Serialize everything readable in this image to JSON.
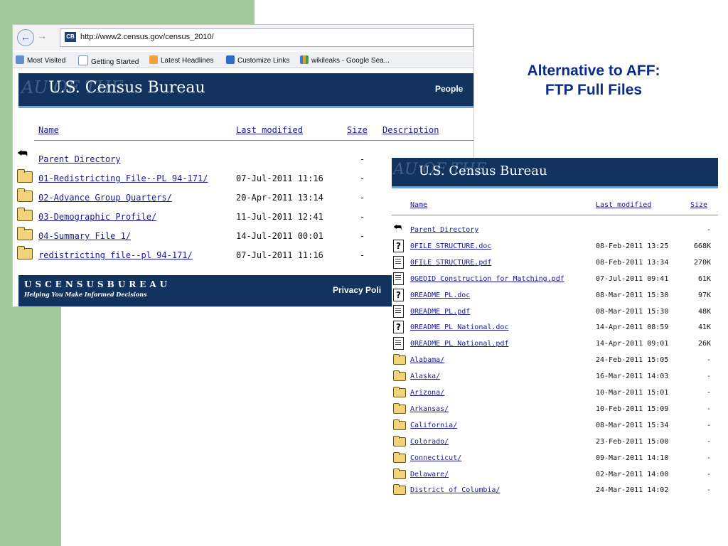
{
  "slide": {
    "title_lines": [
      "Alternative to AFF:",
      "FTP Full Files"
    ]
  },
  "browser": {
    "url": "http://www2.census.gov/census_2010/",
    "site_icon_text": "CB",
    "bookmarks": [
      "Most Visited",
      "Getting Started",
      "Latest Headlines",
      "Customize Links",
      "wikileaks - Google Sea..."
    ]
  },
  "census": {
    "logo_text": "U.S. Census Bureau",
    "watermark_text": "AU OF THE",
    "nav_people": "People",
    "footer_brand": "USCENSUSBUREAU",
    "footer_tagline": "Helping You Make Informed Decisions",
    "footer_privacy": "Privacy Poli"
  },
  "listing1": {
    "headers": {
      "name": "Name",
      "modified": "Last modified",
      "size": "Size",
      "description": "Description"
    },
    "rows": [
      {
        "icon": "back",
        "name": "Parent Directory",
        "modified": "",
        "size": "-"
      },
      {
        "icon": "folder",
        "name": "01-Redistricting File--PL 94-171/",
        "modified": "07-Jul-2011 11:16",
        "size": "-"
      },
      {
        "icon": "folder",
        "name": "02-Advance Group Quarters/",
        "modified": "20-Apr-2011 13:14",
        "size": "-"
      },
      {
        "icon": "folder",
        "name": "03-Demographic Profile/",
        "modified": "11-Jul-2011 12:41",
        "size": "-"
      },
      {
        "icon": "folder",
        "name": "04-Summary File 1/",
        "modified": "14-Jul-2011 00:01",
        "size": "-"
      },
      {
        "icon": "folder",
        "name": "redistricting file--pl 94-171/",
        "modified": "07-Jul-2011 11:16",
        "size": "-"
      }
    ]
  },
  "listing2": {
    "headers": {
      "name": "Name",
      "modified": "Last modified",
      "size": "Size"
    },
    "rows": [
      {
        "icon": "back",
        "name": "Parent Directory",
        "modified": "",
        "size": "-"
      },
      {
        "icon": "unknown",
        "name": "0FILE STRUCTURE.doc",
        "modified": "08-Feb-2011 13:25",
        "size": "668K"
      },
      {
        "icon": "text",
        "name": "0FILE STRUCTURE.pdf",
        "modified": "08-Feb-2011 13:34",
        "size": "270K"
      },
      {
        "icon": "text",
        "name": "0GEOID Construction for Matching.pdf",
        "modified": "07-Jul-2011 09:41",
        "size": "61K"
      },
      {
        "icon": "unknown",
        "name": "0README PL.doc",
        "modified": "08-Mar-2011 15:30",
        "size": "97K"
      },
      {
        "icon": "text",
        "name": "0README PL.pdf",
        "modified": "08-Mar-2011 15:30",
        "size": "48K"
      },
      {
        "icon": "unknown",
        "name": "0README PL National.doc",
        "modified": "14-Apr-2011 08:59",
        "size": "41K"
      },
      {
        "icon": "text",
        "name": "0README PL National.pdf",
        "modified": "14-Apr-2011 09:01",
        "size": "26K"
      },
      {
        "icon": "folder",
        "name": "Alabama/",
        "modified": "24-Feb-2011 15:05",
        "size": "-"
      },
      {
        "icon": "folder",
        "name": "Alaska/",
        "modified": "16-Mar-2011 14:03",
        "size": "-"
      },
      {
        "icon": "folder",
        "name": "Arizona/",
        "modified": "10-Mar-2011 15:01",
        "size": "-"
      },
      {
        "icon": "folder",
        "name": "Arkansas/",
        "modified": "10-Feb-2011 15:09",
        "size": "-"
      },
      {
        "icon": "folder",
        "name": "California/",
        "modified": "08-Mar-2011 15:34",
        "size": "-"
      },
      {
        "icon": "folder",
        "name": "Colorado/",
        "modified": "23-Feb-2011 15:00",
        "size": "-"
      },
      {
        "icon": "folder",
        "name": "Connecticut/",
        "modified": "09-Mar-2011 14:10",
        "size": "-"
      },
      {
        "icon": "folder",
        "name": "Delaware/",
        "modified": "02-Mar-2011 14:00",
        "size": "-"
      },
      {
        "icon": "folder",
        "name": "District of Columbia/",
        "modified": "24-Mar-2011 14:02",
        "size": "-"
      }
    ]
  },
  "colors": {
    "slide_green": "#a1c99a",
    "title_blue": "#0a2b8a",
    "census_navy": "#11335e",
    "census_rule": "#6fa2d6",
    "link_blue": "#1a1a9a"
  }
}
